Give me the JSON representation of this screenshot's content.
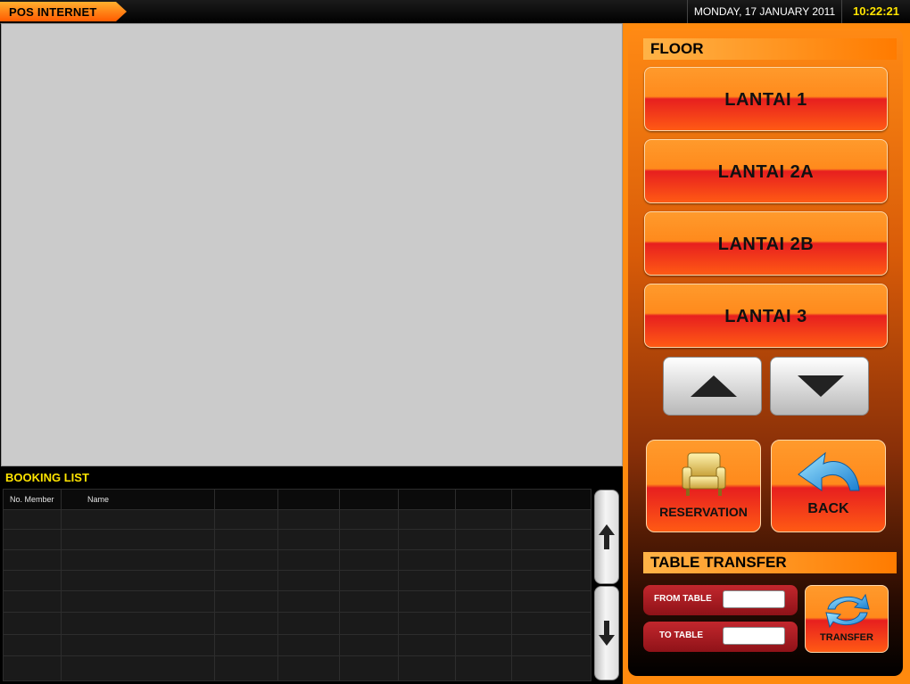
{
  "app": {
    "title": "POS INTERNET"
  },
  "header": {
    "date": "MONDAY, 17 JANUARY 2011",
    "time": "10:22:21"
  },
  "booking_list": {
    "title": "BOOKING LIST",
    "columns": [
      "No. Member",
      "Name",
      "",
      "",
      "",
      "",
      "",
      ""
    ]
  },
  "floor": {
    "title": "FLOOR",
    "items": [
      {
        "label": "LANTAI 1"
      },
      {
        "label": "LANTAI 2A"
      },
      {
        "label": "LANTAI 2B"
      },
      {
        "label": "LANTAI 3"
      }
    ]
  },
  "actions": {
    "reservation_label": "RESERVATION",
    "back_label": "BACK"
  },
  "table_transfer": {
    "title": "TABLE TRANSFER",
    "from_label": "FROM TABLE",
    "from_value": "",
    "to_label": "TO TABLE",
    "to_value": "",
    "transfer_label": "TRANSFER"
  },
  "colors": {
    "accent_orange": "#ff8a0e",
    "accent_red": "#e71f1f",
    "clock_yellow": "#ffe400"
  }
}
